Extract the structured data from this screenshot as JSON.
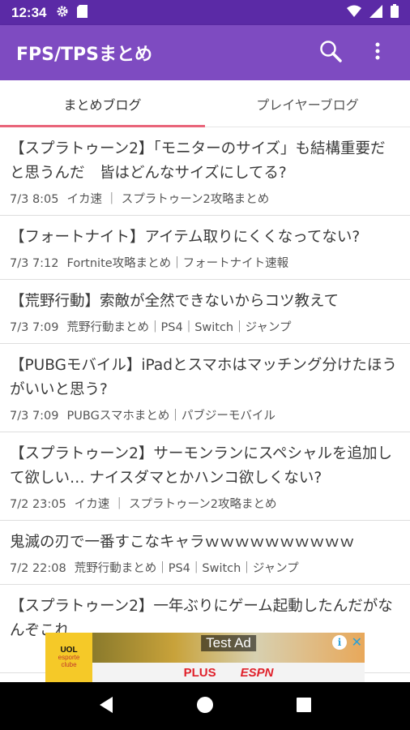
{
  "status_bar": {
    "time": "12:34",
    "icons": [
      "gear-icon",
      "sd-card-icon",
      "wifi-icon",
      "signal-icon",
      "battery-icon"
    ]
  },
  "app_bar": {
    "title": "FPS/TPSまとめ",
    "actions": [
      "search-icon",
      "overflow-menu-icon"
    ]
  },
  "tabs": [
    {
      "label": "まとめブログ",
      "active": true
    },
    {
      "label": "プレイヤーブログ",
      "active": false
    }
  ],
  "articles": [
    {
      "title": "【スプラトゥーン2】「モニターのサイズ」も結構重要だと思うんだ　皆はどんなサイズにしてる?",
      "date": "7/3 8:05",
      "source": "イカ速 ｜ スプラトゥーン2攻略まとめ"
    },
    {
      "title": "【フォートナイト】アイテム取りにくくなってない?",
      "date": "7/3 7:12",
      "source": "Fortnite攻略まとめ｜フォートナイト速報"
    },
    {
      "title": "【荒野行動】索敵が全然できないからコツ教えて",
      "date": "7/3 7:09",
      "source": "荒野行動まとめ｜PS4｜Switch｜ジャンプ"
    },
    {
      "title": "【PUBGモバイル】iPadとスマホはマッチング分けたほうがいいと思う?",
      "date": "7/3 7:09",
      "source": "PUBGスマホまとめ｜パブジーモバイル"
    },
    {
      "title": "【スプラトゥーン2】サーモンランにスペシャルを追加して欲しい… ナイスダマとかハンコ欲しくない?",
      "date": "7/2 23:05",
      "source": "イカ速 ｜ スプラトゥーン2攻略まとめ"
    },
    {
      "title": "鬼滅の刃で一番すこなキャラｗｗｗｗｗｗｗｗｗｗ",
      "date": "7/2 22:08",
      "source": "荒野行動まとめ｜PS4｜Switch｜ジャンプ"
    },
    {
      "title": "【スプラトゥーン2】一年ぶりにゲーム起動したんだがなんぞこれ",
      "date": "",
      "source": ""
    }
  ],
  "ad": {
    "label": "Test Ad",
    "logo_lines": [
      "UOL",
      "esporte",
      "clube"
    ],
    "brand_plus": "PLUS",
    "brand_espn": "ESPN",
    "info_glyph": "i",
    "close_glyph": "✕"
  },
  "colors": {
    "status_bar": "#5b2aa6",
    "app_bar": "#7e4bc1",
    "tab_indicator": "#e9657a"
  }
}
